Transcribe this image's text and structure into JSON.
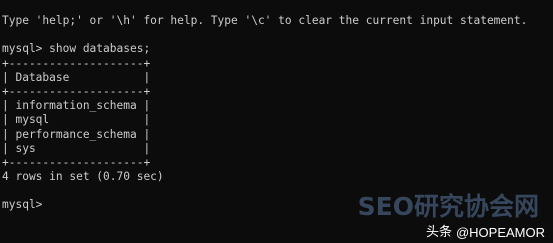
{
  "terminal": {
    "help_line": "Type 'help;' or '\\h' for help. Type '\\c' to clear the current input statement.",
    "command_line": "mysql> show databases;",
    "table_border_top": "+--------------------+",
    "table_header_row": "| Database           |",
    "table_border_mid": "+--------------------+",
    "rows": [
      "| information_schema |",
      "| mysql              |",
      "| performance_schema |",
      "| sys                |"
    ],
    "table_border_bottom": "+--------------------+",
    "result_line": "4 rows in set (0.70 sec)",
    "prompt_line": "mysql> "
  },
  "watermark": {
    "logo_text": "SEO研究协会网",
    "source_label": "头条",
    "author": "@HOPEAMOR"
  }
}
